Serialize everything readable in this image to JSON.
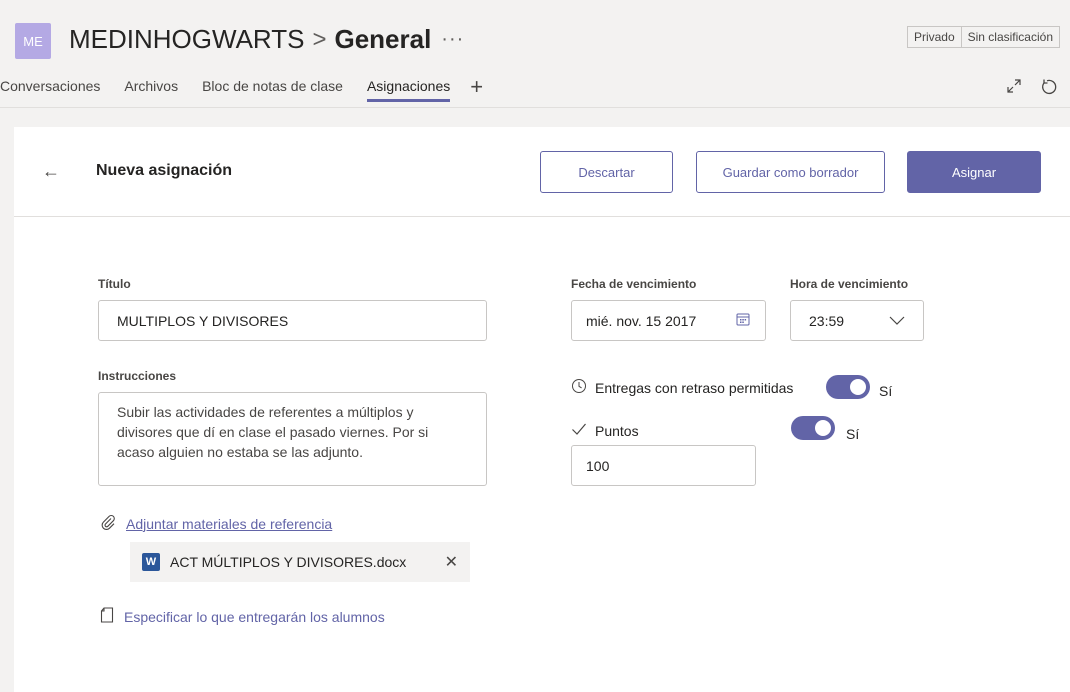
{
  "header": {
    "avatar": "ME",
    "team": "MEDINHOGWARTS",
    "separator": ">",
    "channel": "General",
    "more": "···",
    "badges": [
      "Privado",
      "Sin clasificación"
    ]
  },
  "tabs": [
    {
      "label": "Conversaciones",
      "active": false
    },
    {
      "label": "Archivos",
      "active": false
    },
    {
      "label": "Bloc de notas de clase",
      "active": false
    },
    {
      "label": "Asignaciones",
      "active": true
    }
  ],
  "tab_add": "+",
  "header_icons": [
    "expand-icon",
    "refresh-icon"
  ],
  "topbar": {
    "back": "←",
    "title": "Nueva asignación",
    "discard": "Descartar",
    "save_draft": "Guardar como borrador",
    "assign": "Asignar"
  },
  "form": {
    "title_label": "Título",
    "title_value": "MULTIPLOS Y DIVISORES",
    "instructions_label": "Instrucciones",
    "instructions_value": "Subir las actividades de referentes a múltiplos y divisores que dí en clase el pasado viernes. Por si acaso alguien no estaba se las adjunto.",
    "attach_link": "Adjuntar materiales de referencia",
    "attachment_name": "ACT MÚLTIPLOS Y DIVISORES.docx",
    "attachment_icon": "W",
    "specify_link": "Especificar lo que entregarán los alumnos",
    "due_date_label": "Fecha de vencimiento",
    "due_date_value": "mié. nov. 15 2017",
    "due_time_label": "Hora de vencimiento",
    "due_time_value": "23:59",
    "late_label": "Entregas con retraso permitidas",
    "late_value": "Sí",
    "points_label": "Puntos",
    "points_toggle": "Sí",
    "points_value": "100"
  },
  "colors": {
    "accent": "#6264a7",
    "avatar": "#b4a9e4",
    "word": "#2b579a"
  }
}
